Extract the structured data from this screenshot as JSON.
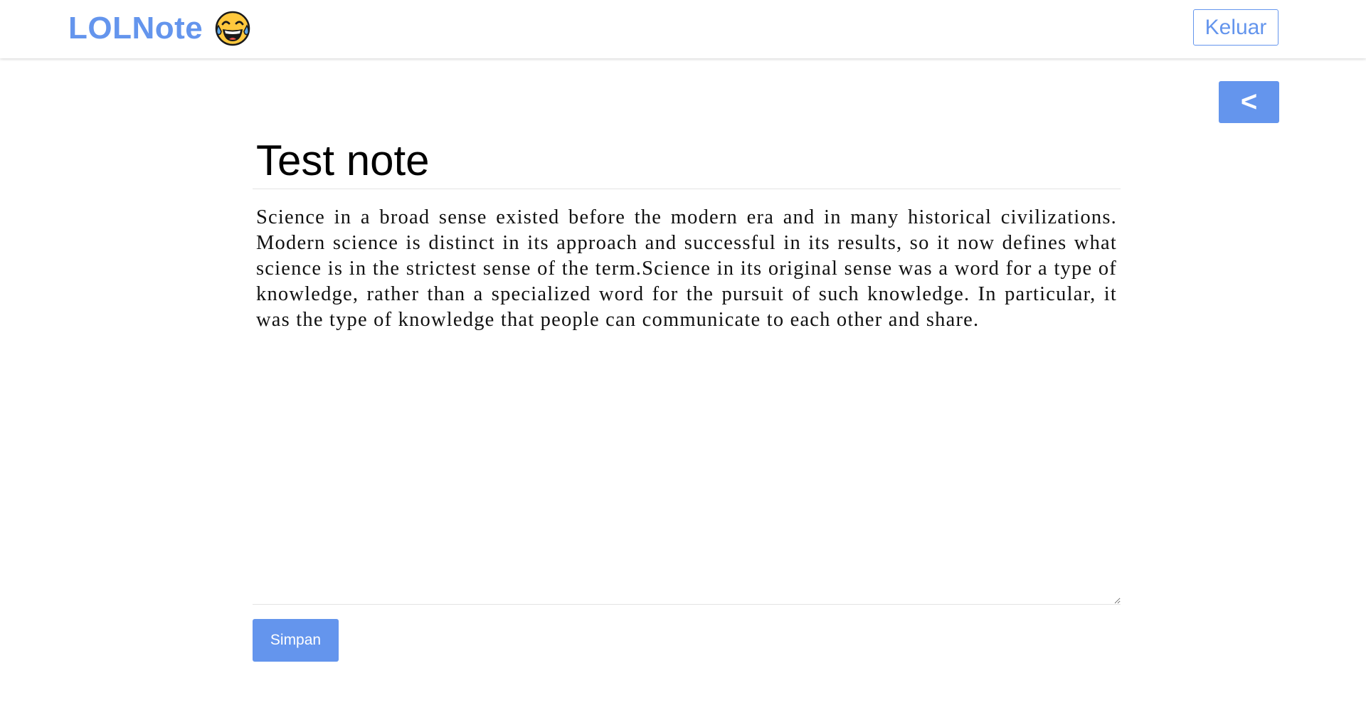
{
  "app": {
    "brand": "LOLNote",
    "brand_icon": "face-with-tears-of-joy-icon"
  },
  "header": {
    "logout_label": "Keluar"
  },
  "actions": {
    "back_label": "<",
    "save_label": "Simpan"
  },
  "note": {
    "title": "Test note",
    "body": "Science in a broad sense existed before the modern era and in many historical civilizations. Modern science is distinct in its approach and successful in its results, so it now defines what science is in the strictest sense of the term.Science in its original sense was a word for a type of knowledge, rather than a specialized word for the pursuit of such knowledge. In particular, it was the type of knowledge that people can communicate to each other and share."
  },
  "colors": {
    "accent": "#6495ED",
    "text": "#111111",
    "divider": "#e3e3e3"
  }
}
